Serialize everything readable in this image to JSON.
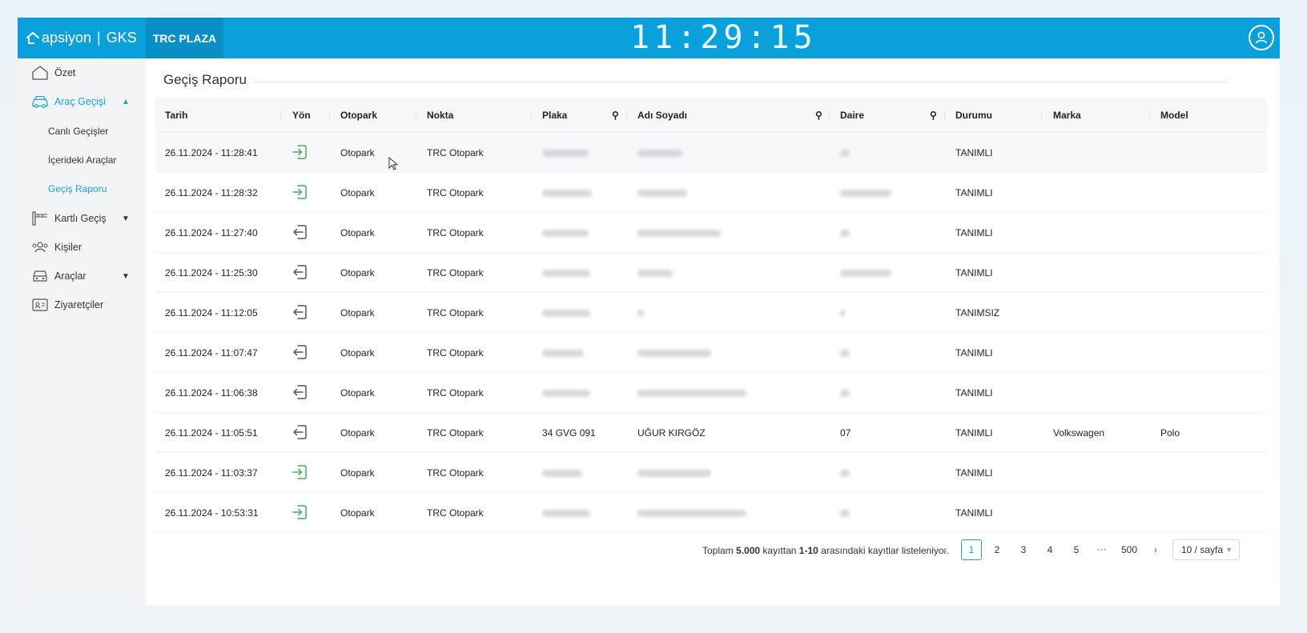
{
  "header": {
    "brand": "apsiyon",
    "product": "GKS",
    "site_name": "TRC PLAZA",
    "clock": "11:29:15"
  },
  "sidebar": {
    "items": [
      {
        "label": "Özet",
        "icon": "home-icon"
      },
      {
        "label": "Araç Geçişi",
        "icon": "car-icon",
        "expanded": true,
        "active": true
      },
      {
        "label": "Kartlı Geçiş",
        "icon": "barrier-icon",
        "expanded": false
      },
      {
        "label": "Kişiler",
        "icon": "people-icon"
      },
      {
        "label": "Araçlar",
        "icon": "car-front-icon",
        "expanded": false
      },
      {
        "label": "Ziyaretçiler",
        "icon": "visitor-card-icon"
      }
    ],
    "subitems": [
      {
        "label": "Canlı Geçişler"
      },
      {
        "label": "İçerideki Araçlar"
      },
      {
        "label": "Geçiş Raporu",
        "current": true
      }
    ]
  },
  "page": {
    "title": "Geçiş Raporu"
  },
  "table": {
    "columns": [
      "Tarih",
      "Yön",
      "Otopark",
      "Nokta",
      "Plaka",
      "Adı Soyadı",
      "Daire",
      "Durumu",
      "Marka",
      "Model"
    ],
    "searchable_columns": [
      "Plaka",
      "Adı Soyadı",
      "Daire"
    ],
    "rows": [
      {
        "tarih": "26.11.2024 - 11:28:41",
        "yon": "in",
        "otopark": "Otopark",
        "nokta": "TRC Otopark",
        "plaka": "",
        "adi": "",
        "daire": "",
        "durum": "TANIMLI",
        "marka": "",
        "model": ""
      },
      {
        "tarih": "26.11.2024 - 11:28:32",
        "yon": "in",
        "otopark": "Otopark",
        "nokta": "TRC Otopark",
        "plaka": "",
        "adi": "",
        "daire": "",
        "durum": "TANIMLI",
        "marka": "",
        "model": ""
      },
      {
        "tarih": "26.11.2024 - 11:27:40",
        "yon": "out",
        "otopark": "Otopark",
        "nokta": "TRC Otopark",
        "plaka": "",
        "adi": "",
        "daire": "",
        "durum": "TANIMLI",
        "marka": "",
        "model": ""
      },
      {
        "tarih": "26.11.2024 - 11:25:30",
        "yon": "out",
        "otopark": "Otopark",
        "nokta": "TRC Otopark",
        "plaka": "",
        "adi": "",
        "daire": "",
        "durum": "TANIMLI",
        "marka": "",
        "model": ""
      },
      {
        "tarih": "26.11.2024 - 11:12:05",
        "yon": "out",
        "otopark": "Otopark",
        "nokta": "TRC Otopark",
        "plaka": "",
        "adi": "",
        "daire": "",
        "durum": "TANIMSIZ",
        "marka": "",
        "model": ""
      },
      {
        "tarih": "26.11.2024 - 11:07:47",
        "yon": "out",
        "otopark": "Otopark",
        "nokta": "TRC Otopark",
        "plaka": "",
        "adi": "",
        "daire": "",
        "durum": "TANIMLI",
        "marka": "",
        "model": ""
      },
      {
        "tarih": "26.11.2024 - 11:06:38",
        "yon": "out",
        "otopark": "Otopark",
        "nokta": "TRC Otopark",
        "plaka": "",
        "adi": "",
        "daire": "",
        "durum": "TANIMLI",
        "marka": "",
        "model": ""
      },
      {
        "tarih": "26.11.2024 - 11:05:51",
        "yon": "out",
        "otopark": "Otopark",
        "nokta": "TRC Otopark",
        "plaka": "34 GVG 091",
        "adi": "UĞUR KIRGÖZ",
        "daire": "07",
        "durum": "TANIMLI",
        "marka": "Volkswagen",
        "model": "Polo"
      },
      {
        "tarih": "26.11.2024 - 11:03:37",
        "yon": "in",
        "otopark": "Otopark",
        "nokta": "TRC Otopark",
        "plaka": "",
        "adi": "",
        "daire": "",
        "durum": "TANIMLI",
        "marka": "",
        "model": ""
      },
      {
        "tarih": "26.11.2024 - 10:53:31",
        "yon": "in",
        "otopark": "Otopark",
        "nokta": "TRC Otopark",
        "plaka": "",
        "adi": "",
        "daire": "",
        "durum": "TANIMLI",
        "marka": "",
        "model": ""
      }
    ]
  },
  "pagination": {
    "summary_prefix": "Toplam",
    "total": "5.000",
    "summary_mid": "kayıttan",
    "range": "1-10",
    "summary_suffix": "arasındaki kayıtlar listeleniyor.",
    "pages": [
      "1",
      "2",
      "3",
      "4",
      "5"
    ],
    "ellipsis": "•••",
    "last_page": "500",
    "current_page": "1",
    "page_size": "10 / sayfa"
  },
  "colors": {
    "brand": "#0aa0dc",
    "site_tab": "#0890c6",
    "accent": "#19a2d8",
    "entry_icon": "#3fae5a",
    "exit_icon": "#555555"
  }
}
